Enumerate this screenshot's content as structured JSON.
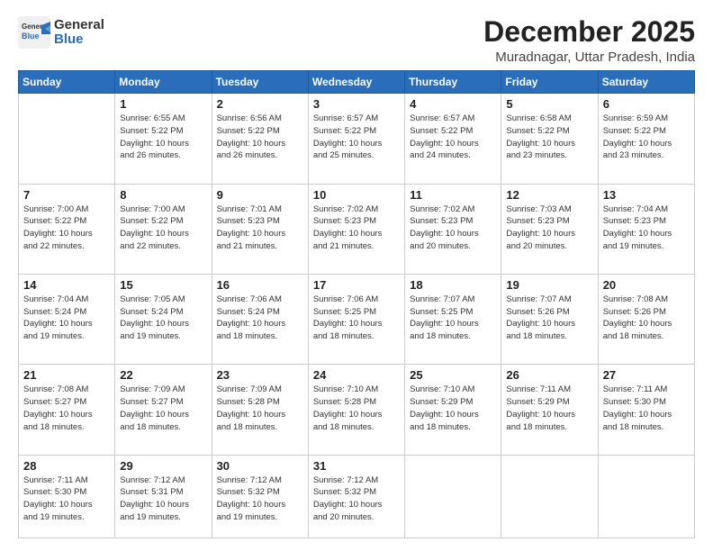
{
  "logo": {
    "general": "General",
    "blue": "Blue"
  },
  "title": "December 2025",
  "location": "Muradnagar, Uttar Pradesh, India",
  "days_header": [
    "Sunday",
    "Monday",
    "Tuesday",
    "Wednesday",
    "Thursday",
    "Friday",
    "Saturday"
  ],
  "weeks": [
    [
      {
        "day": "",
        "info": ""
      },
      {
        "day": "1",
        "info": "Sunrise: 6:55 AM\nSunset: 5:22 PM\nDaylight: 10 hours\nand 26 minutes."
      },
      {
        "day": "2",
        "info": "Sunrise: 6:56 AM\nSunset: 5:22 PM\nDaylight: 10 hours\nand 26 minutes."
      },
      {
        "day": "3",
        "info": "Sunrise: 6:57 AM\nSunset: 5:22 PM\nDaylight: 10 hours\nand 25 minutes."
      },
      {
        "day": "4",
        "info": "Sunrise: 6:57 AM\nSunset: 5:22 PM\nDaylight: 10 hours\nand 24 minutes."
      },
      {
        "day": "5",
        "info": "Sunrise: 6:58 AM\nSunset: 5:22 PM\nDaylight: 10 hours\nand 23 minutes."
      },
      {
        "day": "6",
        "info": "Sunrise: 6:59 AM\nSunset: 5:22 PM\nDaylight: 10 hours\nand 23 minutes."
      }
    ],
    [
      {
        "day": "7",
        "info": "Sunrise: 7:00 AM\nSunset: 5:22 PM\nDaylight: 10 hours\nand 22 minutes."
      },
      {
        "day": "8",
        "info": "Sunrise: 7:00 AM\nSunset: 5:22 PM\nDaylight: 10 hours\nand 22 minutes."
      },
      {
        "day": "9",
        "info": "Sunrise: 7:01 AM\nSunset: 5:23 PM\nDaylight: 10 hours\nand 21 minutes."
      },
      {
        "day": "10",
        "info": "Sunrise: 7:02 AM\nSunset: 5:23 PM\nDaylight: 10 hours\nand 21 minutes."
      },
      {
        "day": "11",
        "info": "Sunrise: 7:02 AM\nSunset: 5:23 PM\nDaylight: 10 hours\nand 20 minutes."
      },
      {
        "day": "12",
        "info": "Sunrise: 7:03 AM\nSunset: 5:23 PM\nDaylight: 10 hours\nand 20 minutes."
      },
      {
        "day": "13",
        "info": "Sunrise: 7:04 AM\nSunset: 5:23 PM\nDaylight: 10 hours\nand 19 minutes."
      }
    ],
    [
      {
        "day": "14",
        "info": "Sunrise: 7:04 AM\nSunset: 5:24 PM\nDaylight: 10 hours\nand 19 minutes."
      },
      {
        "day": "15",
        "info": "Sunrise: 7:05 AM\nSunset: 5:24 PM\nDaylight: 10 hours\nand 19 minutes."
      },
      {
        "day": "16",
        "info": "Sunrise: 7:06 AM\nSunset: 5:24 PM\nDaylight: 10 hours\nand 18 minutes."
      },
      {
        "day": "17",
        "info": "Sunrise: 7:06 AM\nSunset: 5:25 PM\nDaylight: 10 hours\nand 18 minutes."
      },
      {
        "day": "18",
        "info": "Sunrise: 7:07 AM\nSunset: 5:25 PM\nDaylight: 10 hours\nand 18 minutes."
      },
      {
        "day": "19",
        "info": "Sunrise: 7:07 AM\nSunset: 5:26 PM\nDaylight: 10 hours\nand 18 minutes."
      },
      {
        "day": "20",
        "info": "Sunrise: 7:08 AM\nSunset: 5:26 PM\nDaylight: 10 hours\nand 18 minutes."
      }
    ],
    [
      {
        "day": "21",
        "info": "Sunrise: 7:08 AM\nSunset: 5:27 PM\nDaylight: 10 hours\nand 18 minutes."
      },
      {
        "day": "22",
        "info": "Sunrise: 7:09 AM\nSunset: 5:27 PM\nDaylight: 10 hours\nand 18 minutes."
      },
      {
        "day": "23",
        "info": "Sunrise: 7:09 AM\nSunset: 5:28 PM\nDaylight: 10 hours\nand 18 minutes."
      },
      {
        "day": "24",
        "info": "Sunrise: 7:10 AM\nSunset: 5:28 PM\nDaylight: 10 hours\nand 18 minutes."
      },
      {
        "day": "25",
        "info": "Sunrise: 7:10 AM\nSunset: 5:29 PM\nDaylight: 10 hours\nand 18 minutes."
      },
      {
        "day": "26",
        "info": "Sunrise: 7:11 AM\nSunset: 5:29 PM\nDaylight: 10 hours\nand 18 minutes."
      },
      {
        "day": "27",
        "info": "Sunrise: 7:11 AM\nSunset: 5:30 PM\nDaylight: 10 hours\nand 18 minutes."
      }
    ],
    [
      {
        "day": "28",
        "info": "Sunrise: 7:11 AM\nSunset: 5:30 PM\nDaylight: 10 hours\nand 19 minutes."
      },
      {
        "day": "29",
        "info": "Sunrise: 7:12 AM\nSunset: 5:31 PM\nDaylight: 10 hours\nand 19 minutes."
      },
      {
        "day": "30",
        "info": "Sunrise: 7:12 AM\nSunset: 5:32 PM\nDaylight: 10 hours\nand 19 minutes."
      },
      {
        "day": "31",
        "info": "Sunrise: 7:12 AM\nSunset: 5:32 PM\nDaylight: 10 hours\nand 20 minutes."
      },
      {
        "day": "",
        "info": ""
      },
      {
        "day": "",
        "info": ""
      },
      {
        "day": "",
        "info": ""
      }
    ]
  ]
}
